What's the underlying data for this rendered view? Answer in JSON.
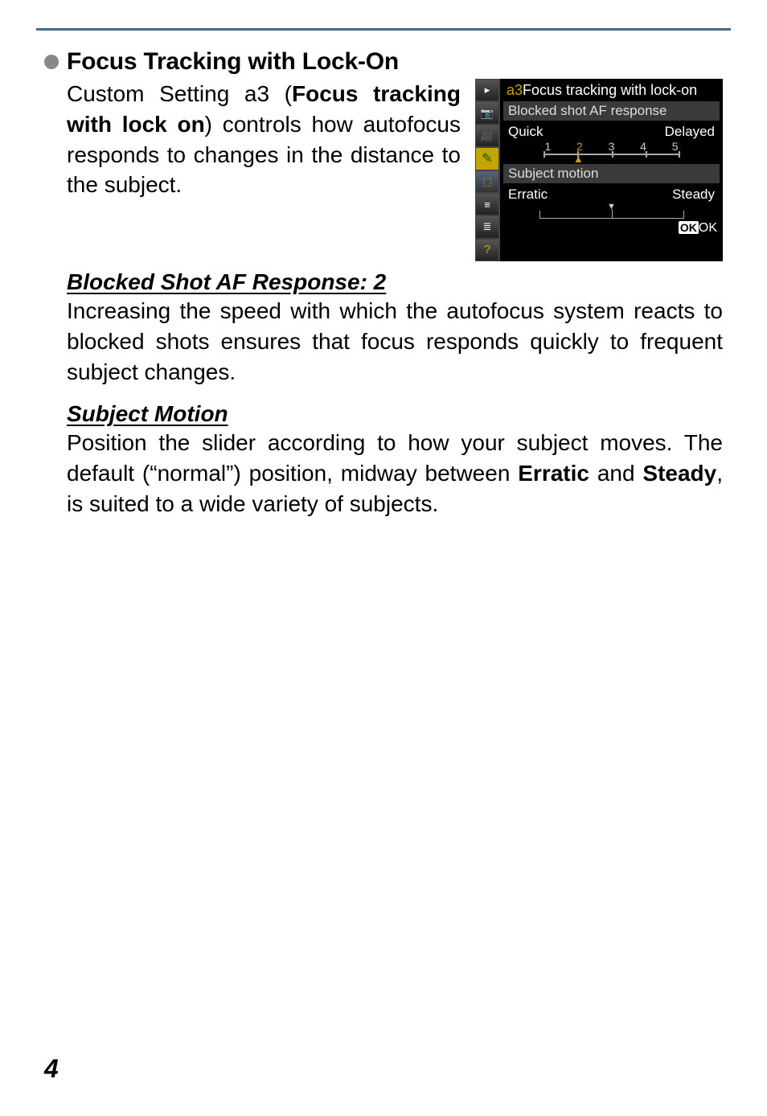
{
  "section": {
    "title": "Focus Tracking with Lock-On",
    "intro_parts": {
      "p1": "Custom Setting a3 (",
      "b1": "Focus tracking with lock on",
      "p2": ") controls how autofo­cus responds to changes in the dis­tance to the subject."
    }
  },
  "camera": {
    "title_prefix": "a3",
    "title": "Focus tracking with lock-on",
    "group1": {
      "label": "Blocked shot AF response",
      "left": "Quick",
      "right": "Delayed",
      "ticks": [
        "1",
        "2",
        "3",
        "4",
        "5"
      ],
      "selected_index": 1
    },
    "group2": {
      "label": "Subject motion",
      "left": "Erratic",
      "right": "Steady"
    },
    "ok_boxed": "OK",
    "ok_suffix": "OK",
    "side_icons": [
      "play",
      "camera",
      "video",
      "pencil",
      "retouch",
      "menu",
      "list",
      "help"
    ]
  },
  "sub1": {
    "title": "Blocked Shot AF Response: 2",
    "body": "Increasing the speed with which the autofocus system re­acts to blocked shots ensures that focus responds quickly to frequent subject changes."
  },
  "sub2": {
    "title": "Subject Motion",
    "body_parts": {
      "p1": "Position the slider according to how your subject moves. The default (“normal”) position, midway between ",
      "b1": "Erratic",
      "p2": " and ",
      "b2": "Steady",
      "p3": ", is suited to a wide variety of subjects."
    }
  },
  "page_number": "4"
}
